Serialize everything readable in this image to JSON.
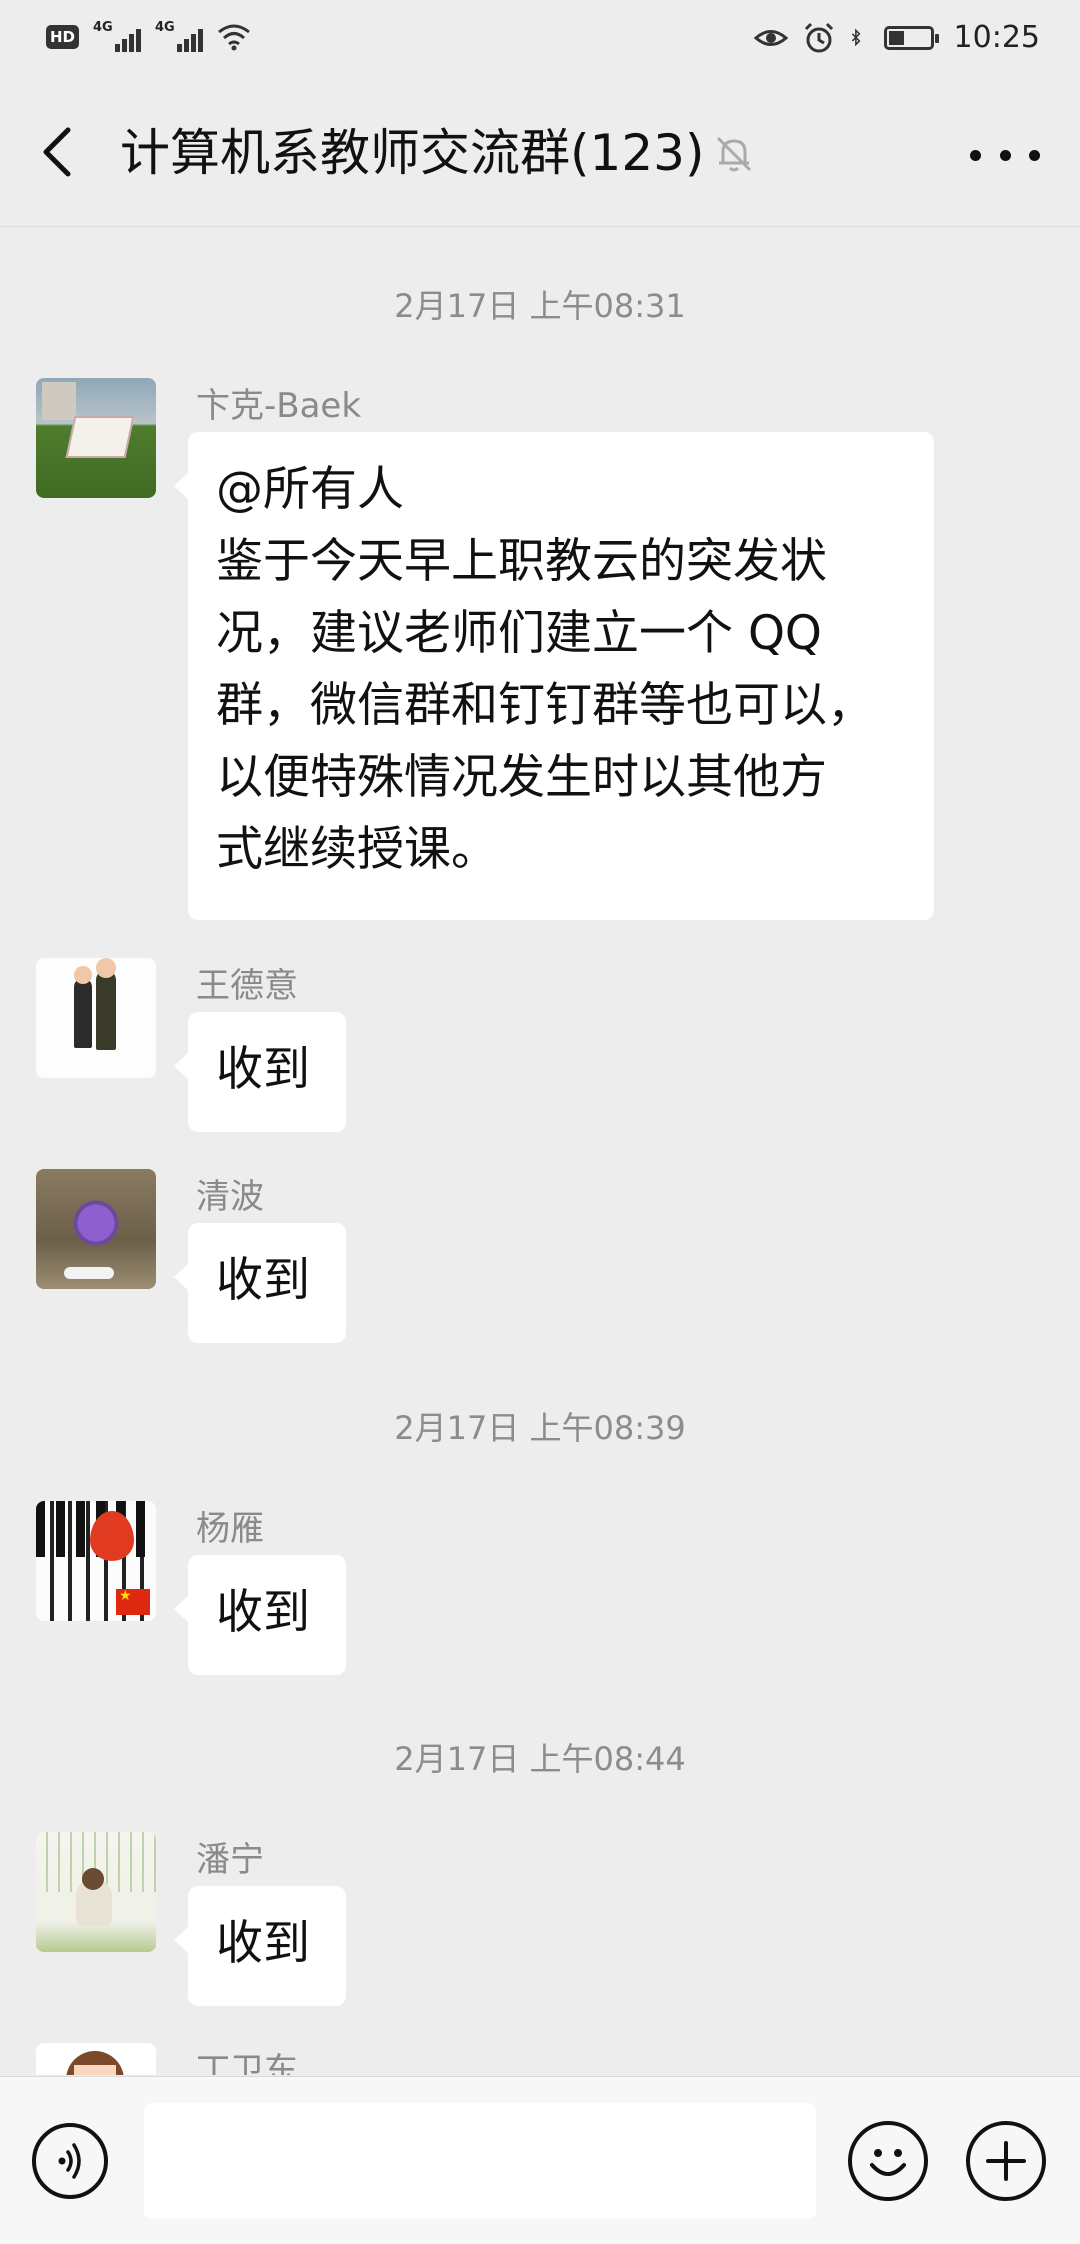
{
  "status_bar": {
    "hd_badge": "HD",
    "sim1_label": "4G",
    "sim2_label": "4G",
    "time": "10:25",
    "battery_level": 0.4
  },
  "header": {
    "title": "计算机系教师交流群(123)",
    "muted": true
  },
  "messages": [
    {
      "type": "timestamp",
      "text": "2月17日 上午08:31"
    },
    {
      "type": "message",
      "sender": "卞克-Baek",
      "avatar": "avatar-baek",
      "lines": [
        "@所有人",
        "鉴于今天早上职教云的突发状",
        "况，建议老师们建立一个 QQ",
        "群，微信群和钉钉群等也可以，",
        "以便特殊情况发生时以其他方",
        "式继续授课。"
      ]
    },
    {
      "type": "message",
      "sender": "王德意",
      "avatar": "avatar-wang",
      "lines": [
        "收到"
      ]
    },
    {
      "type": "message",
      "sender": "清波",
      "avatar": "avatar-qingbo",
      "lines": [
        "收到"
      ]
    },
    {
      "type": "timestamp",
      "text": "2月17日 上午08:39"
    },
    {
      "type": "message",
      "sender": "杨雁",
      "avatar": "avatar-yang",
      "lines": [
        "收到"
      ]
    },
    {
      "type": "timestamp",
      "text": "2月17日 上午08:44"
    },
    {
      "type": "message",
      "sender": "潘宁",
      "avatar": "avatar-pan",
      "lines": [
        "收到"
      ]
    },
    {
      "type": "message",
      "sender": "丁卫东",
      "avatar": "avatar-ding",
      "lines": []
    }
  ],
  "input_bar": {
    "value": "",
    "placeholder": ""
  },
  "icons": {
    "back": "back-arrow-icon",
    "mute": "mute-bell-icon",
    "more": "more-dots-icon",
    "voice": "voice-icon",
    "emoji": "emoji-icon",
    "plus": "plus-icon"
  }
}
